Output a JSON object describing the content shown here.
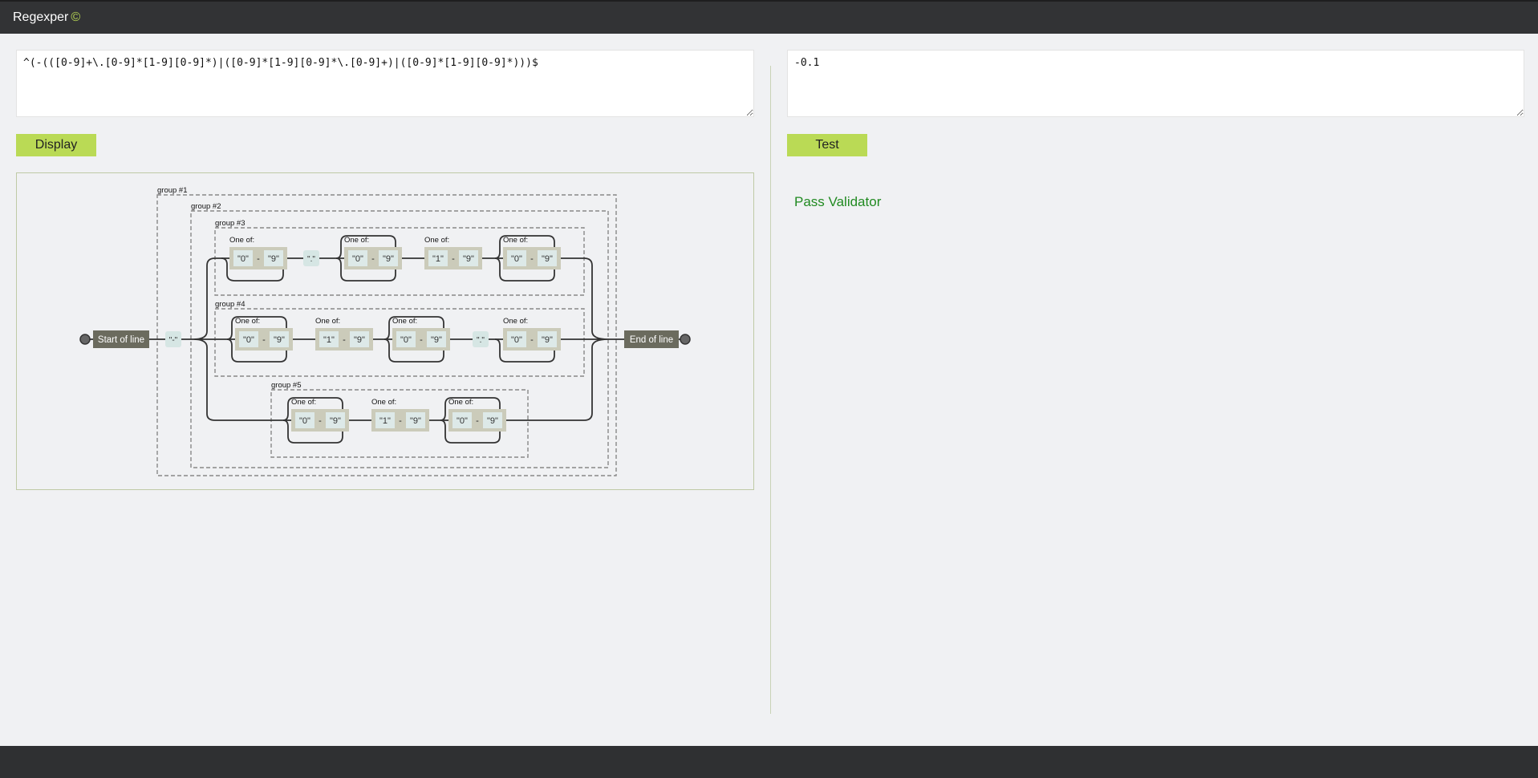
{
  "app": {
    "title": "Regexper",
    "copyright_symbol": "©"
  },
  "regex_input": {
    "value": "^(-(([0-9]+\\.[0-9]*[1-9][0-9]*)|([0-9]*[1-9][0-9]*\\.[0-9]+)|([0-9]*[1-9][0-9]*)))$"
  },
  "test_input": {
    "value": "-0.1"
  },
  "buttons": {
    "display": "Display",
    "test": "Test"
  },
  "result": {
    "text": "Pass Validator",
    "color": "#218a21"
  },
  "diagram": {
    "start_label": "Start of line",
    "end_label": "End of line",
    "minus_literal": "\"-\"",
    "dot_literal": "\".\"",
    "one_of": "One of:",
    "dash": "-",
    "groups": [
      "group #1",
      "group #2",
      "group #3",
      "group #4",
      "group #5"
    ],
    "chars": {
      "zero": "\"0\"",
      "one": "\"1\"",
      "nine": "\"9\""
    }
  },
  "colors": {
    "accent": "#bada55",
    "topbar": "#323335",
    "result": "#218a21"
  }
}
